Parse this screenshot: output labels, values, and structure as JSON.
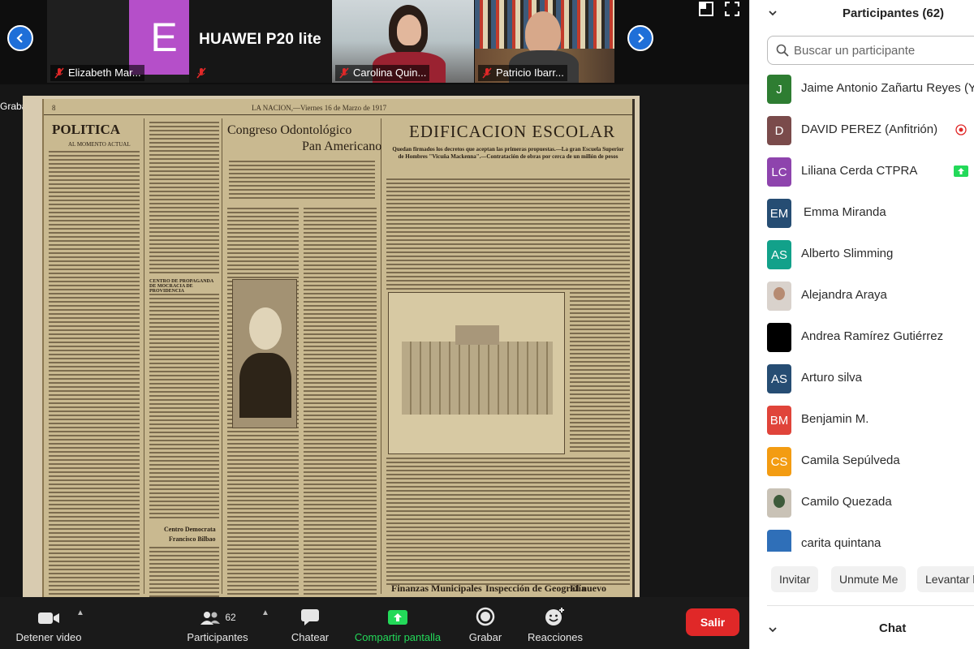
{
  "window": {
    "recording_label": "Grabando"
  },
  "strip": {
    "tiles": [
      {
        "name": "Elizabeth Mar...",
        "initial": "E",
        "avatar_color": "#b54fc9"
      },
      {
        "name": "",
        "device_label": "HUAWEI P20 lite"
      },
      {
        "name": "Carolina Quin..."
      },
      {
        "name": "Patricio Ibarr..."
      }
    ]
  },
  "document": {
    "header_left": "8",
    "header_center": "LA NACION,—Viernes 16 de Marzo de 1917",
    "col1_title": "POLITICA",
    "col1_sub": "AL MOMENTO ACTUAL",
    "col2_title": "Congreso Odontológico",
    "col2_title2": "Pan Americano",
    "col3_title": "EDIFICACION ESCOLAR",
    "col3_sub": "Quedan firmados los decretos que aceptan las primeras propuestas.—La gran Escuela Superior de Hombres \"Vicuña Mackenna\".—Contratación de obras por cerca de un millón de pesos",
    "col2_section": "CENTRO DE PROPAGANDA DE MOCRACIA DE PROVIDENCIA",
    "col2_section2": "Centro Democrata",
    "col2_section3": "Francisco Bilbao",
    "foot1": "Finanzas Municipales",
    "foot2": "Inspección de Geografía",
    "foot3": "El nuevo Ministro de"
  },
  "toolbar": {
    "video_label": "Detener video",
    "participants_label": "Participantes",
    "participants_count": "62",
    "chat_label": "Chatear",
    "share_label": "Compartir pantalla",
    "record_label": "Grabar",
    "reactions_label": "Reacciones",
    "leave_label": "Salir",
    "share_color": "#23d959",
    "leave_color": "#e02828"
  },
  "sidebar": {
    "title": "Participantes (62)",
    "search_placeholder": "Buscar un participante",
    "participants": [
      {
        "initials": "J",
        "name": "Jaime Antonio Zañartu Reyes (Yo)",
        "color": "#2e7d32"
      },
      {
        "initials": "D",
        "name": "DAVID PEREZ (Anfitrión)",
        "color": "#7a4b4b",
        "badge": "recording-icon"
      },
      {
        "initials": "LC",
        "name": "Liliana Cerda CTPRA",
        "color": "#8e44ad",
        "badge": "share-screen-icon"
      },
      {
        "initials": "EM",
        "name": "Emma Miranda",
        "color": "#264d73"
      },
      {
        "initials": "AS",
        "name": "Alberto Slimming",
        "color": "#12a18a"
      },
      {
        "initials": "",
        "name": "Alejandra Araya",
        "color": "#d9d2cc"
      },
      {
        "initials": "",
        "name": "Andrea Ramírez Gutiérrez",
        "color": "#000000"
      },
      {
        "initials": "AS",
        "name": "Arturo silva",
        "color": "#264d73"
      },
      {
        "initials": "BM",
        "name": "Benjamin M.",
        "color": "#e0443a"
      },
      {
        "initials": "CS",
        "name": "Camila Sepúlveda",
        "color": "#f39c12"
      },
      {
        "initials": "",
        "name": "Camilo Quezada",
        "color": "#c9c2b6"
      },
      {
        "initials": "",
        "name": "carita quintana",
        "color": "#2f6fb8"
      }
    ],
    "invite_label": "Invitar",
    "unmute_label": "Unmute Me",
    "raise_label": "Levantar la",
    "chat_title": "Chat"
  }
}
